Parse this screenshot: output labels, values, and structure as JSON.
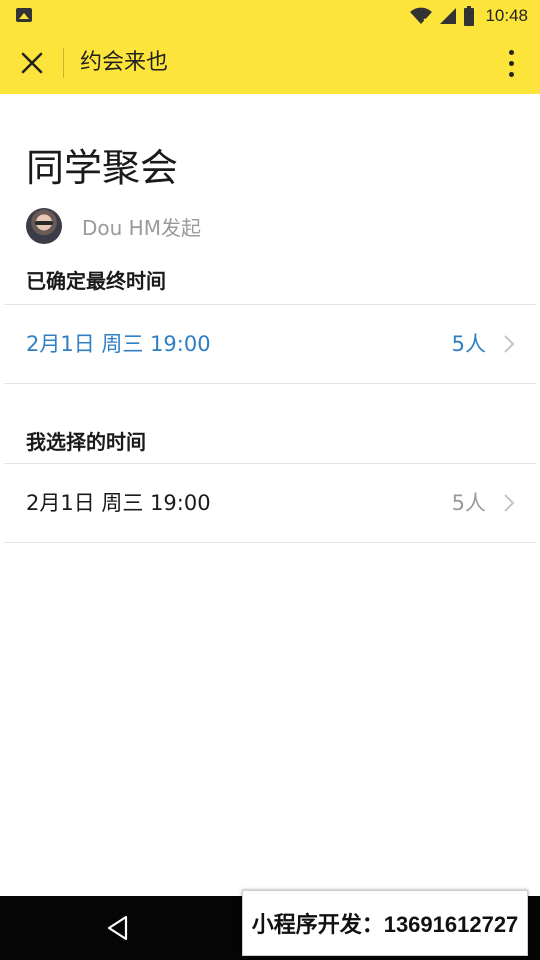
{
  "status_bar": {
    "time": "10:48",
    "icons": [
      "image-icon",
      "wifi-icon",
      "cell-signal-icon",
      "battery-icon"
    ]
  },
  "app_bar": {
    "title": "约会来也",
    "close_icon": "close-icon",
    "more_icon": "more-vert-icon",
    "background_color": "#fde43a"
  },
  "event": {
    "title": "同学聚会",
    "organizer": "Dou HM发起"
  },
  "sections": {
    "confirmed": {
      "heading": "已确定最终时间",
      "time": "2月1日 周三 19:00",
      "count": "5人",
      "accent_color": "#2f7fc4"
    },
    "mine": {
      "heading": "我选择的时间",
      "time": "2月1日 周三 19:00",
      "count": "5人"
    }
  },
  "nav_bar": {
    "back_icon": "nav-back-icon"
  },
  "watermark": {
    "text": "小程序开发：13691612727"
  }
}
